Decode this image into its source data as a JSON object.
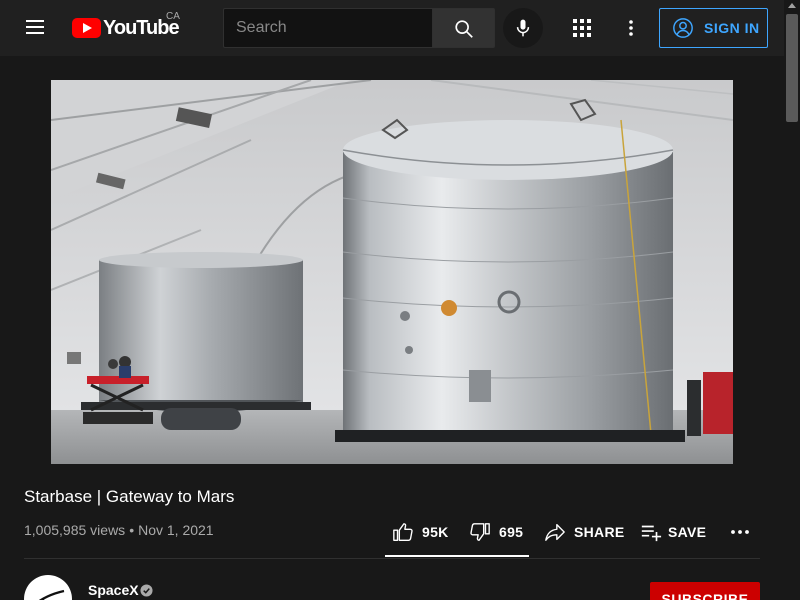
{
  "header": {
    "logo_text": "YouTube",
    "country_code": "CA",
    "search_placeholder": "Search",
    "sign_in_label": "SIGN IN",
    "accent_color": "#3ea6ff",
    "brand_color": "#ff0000"
  },
  "icons": {
    "menu": "hamburger-icon",
    "search": "search-icon",
    "mic": "mic-icon",
    "apps": "apps-grid-icon",
    "more": "more-vert-icon",
    "account": "account-circle-icon",
    "like": "thumb-up-icon",
    "dislike": "thumb-down-icon",
    "share": "share-icon",
    "save": "playlist-add-icon",
    "more_actions": "more-horiz-icon",
    "verified": "verified-check-icon"
  },
  "video": {
    "title": "Starbase | Gateway to Mars",
    "views": "1,005,985 views",
    "date": "Nov 1, 2021"
  },
  "actions": {
    "likes": "95K",
    "dislikes": "695",
    "share_label": "SHARE",
    "save_label": "SAVE"
  },
  "channel": {
    "name": "SpaceX",
    "subscribe_label": "SUBSCRIBE",
    "subscribe_color": "#cc0000"
  }
}
